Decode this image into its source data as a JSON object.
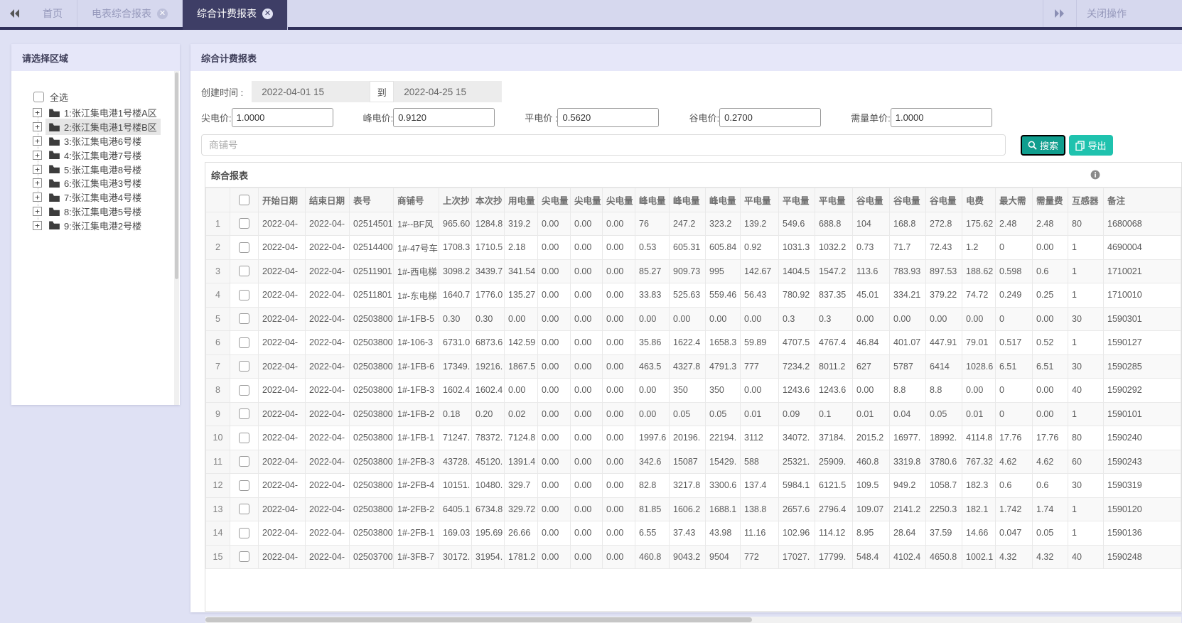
{
  "topbar": {
    "tabs": [
      {
        "label": "首页",
        "active": false,
        "closable": false
      },
      {
        "label": "电表综合报表",
        "active": false,
        "closable": true
      },
      {
        "label": "综合计费报表",
        "active": true,
        "closable": true
      }
    ],
    "close_menu_label": "关闭操作"
  },
  "sidebar": {
    "title": "请选择区域",
    "select_all_label": "全选",
    "selected_index": 1,
    "items": [
      "1:张江集电港1号楼A区",
      "2:张江集电港1号楼B区",
      "3:张江集电港6号楼",
      "4:张江集电港7号楼",
      "5:张江集电港8号楼",
      "6:张江集电港3号楼",
      "7:张江集电港4号楼",
      "8:张江集电港5号楼",
      "9:张江集电港2号楼"
    ]
  },
  "main": {
    "title": "综合计费报表",
    "filters": {
      "create_time_label": "创建时间 :",
      "date_from": "2022-04-01 15",
      "to_label": "到",
      "date_to": "2022-04-25 15",
      "prices": [
        {
          "label": "尖电价:",
          "value": "1.0000"
        },
        {
          "label": "峰电价:",
          "value": "0.9120"
        },
        {
          "label": "平电价 :",
          "value": "0.5620"
        },
        {
          "label": "谷电价:",
          "value": "0.2700"
        },
        {
          "label": "需量单价:",
          "value": "1.0000"
        }
      ],
      "shop_no_placeholder": "商铺号",
      "search_label": "搜索",
      "export_label": "导出"
    },
    "table": {
      "title": "综合报表",
      "columns": [
        "开始日期",
        "结束日期",
        "表号",
        "商铺号",
        "上次抄",
        "本次抄",
        "用电量",
        "尖电量",
        "尖电量",
        "尖电量",
        "峰电量",
        "峰电量",
        "峰电量",
        "平电量",
        "平电量",
        "平电量",
        "谷电量",
        "谷电量",
        "谷电量",
        "电费",
        "最大需",
        "需量费",
        "互感器",
        "备注"
      ],
      "rows": [
        [
          "2022-04-",
          "2022-04-",
          "02514501",
          "1#--BF风",
          "965.60",
          "1284.8",
          "319.2",
          "0.00",
          "0.00",
          "0.00",
          "76",
          "247.2",
          "323.2",
          "139.2",
          "549.6",
          "688.8",
          "104",
          "168.8",
          "272.8",
          "175.62",
          "2.48",
          "2.48",
          "80",
          "1680068"
        ],
        [
          "2022-04-",
          "2022-04-",
          "02514400",
          "1#-47号车",
          "1708.3",
          "1710.5",
          "2.18",
          "0.00",
          "0.00",
          "0.00",
          "0.53",
          "605.31",
          "605.84",
          "0.92",
          "1031.3",
          "1032.2",
          "0.73",
          "71.7",
          "72.43",
          "1.2",
          "0",
          "0.00",
          "1",
          "4690004"
        ],
        [
          "2022-04-",
          "2022-04-",
          "02511901",
          "1#-西电梯",
          "3098.2",
          "3439.7",
          "341.54",
          "0.00",
          "0.00",
          "0.00",
          "85.27",
          "909.73",
          "995",
          "142.67",
          "1404.5",
          "1547.2",
          "113.6",
          "783.93",
          "897.53",
          "188.62",
          "0.598",
          "0.6",
          "1",
          "1710021"
        ],
        [
          "2022-04-",
          "2022-04-",
          "02511801",
          "1#-东电梯",
          "1640.7",
          "1776.0",
          "135.27",
          "0.00",
          "0.00",
          "0.00",
          "33.83",
          "525.63",
          "559.46",
          "56.43",
          "780.92",
          "837.35",
          "45.01",
          "334.21",
          "379.22",
          "74.72",
          "0.249",
          "0.25",
          "1",
          "1710010"
        ],
        [
          "2022-04-",
          "2022-04-",
          "02503800",
          "1#-1FB-5",
          "0.30",
          "0.30",
          "0.00",
          "0.00",
          "0.00",
          "0.00",
          "0.00",
          "0.00",
          "0.00",
          "0.00",
          "0.3",
          "0.3",
          "0.00",
          "0.00",
          "0.00",
          "0.00",
          "0",
          "0.00",
          "30",
          "1590301"
        ],
        [
          "2022-04-",
          "2022-04-",
          "02503800",
          "1#-106-3",
          "6731.0",
          "6873.6",
          "142.59",
          "0.00",
          "0.00",
          "0.00",
          "35.86",
          "1622.4",
          "1658.3",
          "59.89",
          "4707.5",
          "4767.4",
          "46.84",
          "401.07",
          "447.91",
          "79.01",
          "0.517",
          "0.52",
          "1",
          "1590127"
        ],
        [
          "2022-04-",
          "2022-04-",
          "02503800",
          "1#-1FB-6",
          "17349.",
          "19216.",
          "1867.5",
          "0.00",
          "0.00",
          "0.00",
          "463.5",
          "4327.8",
          "4791.3",
          "777",
          "7234.2",
          "8011.2",
          "627",
          "5787",
          "6414",
          "1028.6",
          "6.51",
          "6.51",
          "30",
          "1590285"
        ],
        [
          "2022-04-",
          "2022-04-",
          "02503800",
          "1#-1FB-3",
          "1602.4",
          "1602.4",
          "0.00",
          "0.00",
          "0.00",
          "0.00",
          "0.00",
          "350",
          "350",
          "0.00",
          "1243.6",
          "1243.6",
          "0.00",
          "8.8",
          "8.8",
          "0.00",
          "0",
          "0.00",
          "40",
          "1590292"
        ],
        [
          "2022-04-",
          "2022-04-",
          "02503800",
          "1#-1FB-2",
          "0.18",
          "0.20",
          "0.02",
          "0.00",
          "0.00",
          "0.00",
          "0.00",
          "0.05",
          "0.05",
          "0.01",
          "0.09",
          "0.1",
          "0.01",
          "0.04",
          "0.05",
          "0.01",
          "0",
          "0.00",
          "1",
          "1590101"
        ],
        [
          "2022-04-",
          "2022-04-",
          "02503800",
          "1#-1FB-1",
          "71247.",
          "78372.",
          "7124.8",
          "0.00",
          "0.00",
          "0.00",
          "1997.6",
          "20196.",
          "22194.",
          "3112",
          "34072.",
          "37184.",
          "2015.2",
          "16977.",
          "18992.",
          "4114.8",
          "17.76",
          "17.76",
          "80",
          "1590240"
        ],
        [
          "2022-04-",
          "2022-04-",
          "02503800",
          "1#-2FB-3",
          "43728.",
          "45120.",
          "1391.4",
          "0.00",
          "0.00",
          "0.00",
          "342.6",
          "15087",
          "15429.",
          "588",
          "25321.",
          "25909.",
          "460.8",
          "3319.8",
          "3780.6",
          "767.32",
          "4.62",
          "4.62",
          "60",
          "1590243"
        ],
        [
          "2022-04-",
          "2022-04-",
          "02503800",
          "1#-2FB-4",
          "10151.",
          "10480.",
          "329.7",
          "0.00",
          "0.00",
          "0.00",
          "82.8",
          "3217.8",
          "3300.6",
          "137.4",
          "5984.1",
          "6121.5",
          "109.5",
          "949.2",
          "1058.7",
          "182.3",
          "0.6",
          "0.6",
          "30",
          "1590319"
        ],
        [
          "2022-04-",
          "2022-04-",
          "02503800",
          "1#-2FB-2",
          "6405.1",
          "6734.8",
          "329.72",
          "0.00",
          "0.00",
          "0.00",
          "81.85",
          "1606.2",
          "1688.1",
          "138.8",
          "2657.6",
          "2796.4",
          "109.07",
          "2141.2",
          "2250.3",
          "182.1",
          "1.742",
          "1.74",
          "1",
          "1590120"
        ],
        [
          "2022-04-",
          "2022-04-",
          "02503800",
          "1#-2FB-1",
          "169.03",
          "195.69",
          "26.66",
          "0.00",
          "0.00",
          "0.00",
          "6.55",
          "37.43",
          "43.98",
          "11.16",
          "102.96",
          "114.12",
          "8.95",
          "28.64",
          "37.59",
          "14.66",
          "0.047",
          "0.05",
          "1",
          "1590136"
        ],
        [
          "2022-04-",
          "2022-04-",
          "02503700",
          "1#-3FB-7",
          "30172.",
          "31954.",
          "1781.2",
          "0.00",
          "0.00",
          "0.00",
          "460.8",
          "9043.2",
          "9504",
          "772",
          "17027.",
          "17799.",
          "548.4",
          "4102.4",
          "4650.8",
          "1002.1",
          "4.32",
          "4.32",
          "40",
          "1590248"
        ]
      ]
    }
  },
  "colors": {
    "accent_teal": "#109e8e",
    "accent_teal_light": "#1fc2ae",
    "tab_active_bg": "#3e3e66",
    "topbar_bg": "#d6d8ee",
    "page_bg": "#dfe1f4"
  }
}
